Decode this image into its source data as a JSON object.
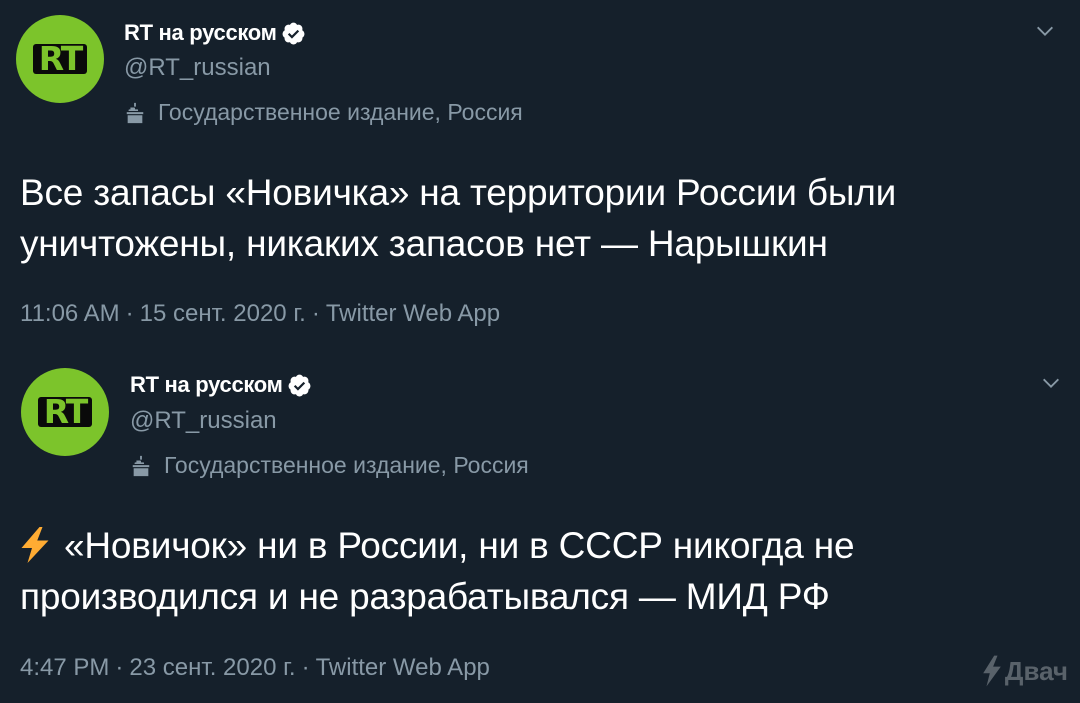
{
  "colors": {
    "background": "#15202b",
    "secondary_text": "#8899a6",
    "avatar_green": "#7cc42b",
    "bolt_yellow": "#ffac33"
  },
  "tweets": [
    {
      "account": {
        "name": "RT на русском",
        "handle": "@RT_russian",
        "avatar_text": "RT",
        "verified": true,
        "label": "Государственное издание, Россия"
      },
      "text_lines": [
        "Все запасы «Новичка» на территории России были",
        "уничтожены, никаких запасов нет — Нарышкин"
      ],
      "time": "11:06 AM",
      "date": "15 сент. 2020 г.",
      "source": "Twitter Web App"
    },
    {
      "account": {
        "name": "RT на русском",
        "handle": "@RT_russian",
        "avatar_text": "RT",
        "verified": true,
        "label": "Государственное издание, Россия"
      },
      "text_lines": [
        "«Новичок» ни в России, ни в СССР никогда не",
        "производился и не разрабатывался — МИД РФ"
      ],
      "leading_icon": "high-voltage-emoji",
      "time": "4:47 PM",
      "date": "23 сент. 2020 г.",
      "source": "Twitter Web App"
    }
  ],
  "meta_separator": "·",
  "watermark": {
    "icon": "lightning-icon",
    "text": "Двач"
  }
}
